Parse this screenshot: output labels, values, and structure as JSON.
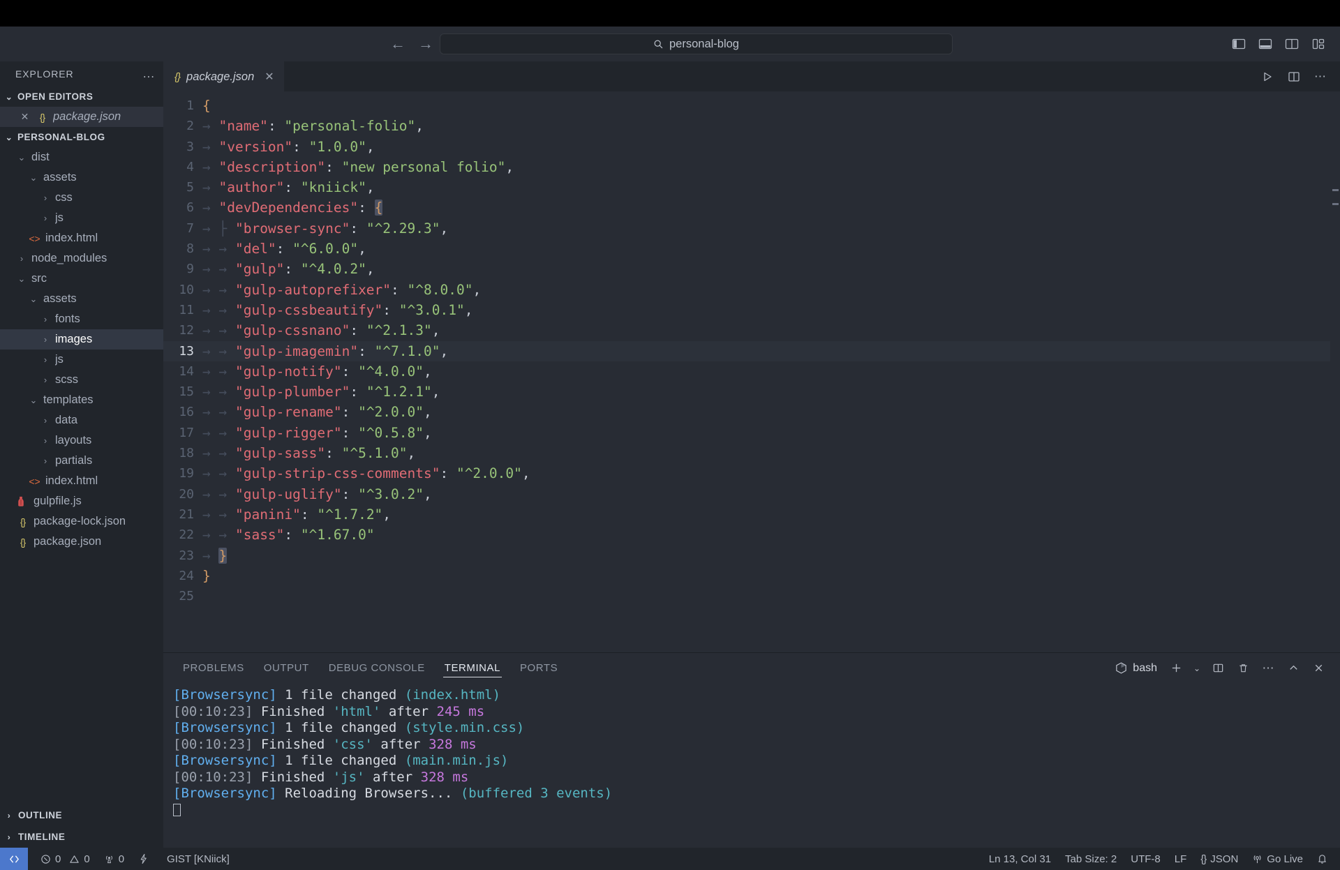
{
  "titlebar": {
    "back_icon": "arrow-left-icon",
    "forward_icon": "arrow-right-icon",
    "search_placeholder": "personal-blog",
    "search_value": "personal-blog",
    "search_icon": "search-icon",
    "layout_icons": [
      "toggle-primary-sidebar-icon",
      "toggle-panel-icon",
      "toggle-secondary-sidebar-icon",
      "customize-layout-icon"
    ]
  },
  "sidebar": {
    "header": "EXPLORER",
    "header_more": "...",
    "open_editors": {
      "label": "OPEN EDITORS",
      "items": [
        {
          "name": "package.json",
          "icon": "json-icon",
          "close_icon": "close-icon",
          "selected": true
        }
      ]
    },
    "project": {
      "label": "PERSONAL-BLOG",
      "tree": [
        {
          "name": "dist",
          "type": "folder",
          "expanded": true,
          "depth": 1
        },
        {
          "name": "assets",
          "type": "folder",
          "expanded": true,
          "depth": 2
        },
        {
          "name": "css",
          "type": "folder",
          "expanded": false,
          "depth": 3
        },
        {
          "name": "js",
          "type": "folder",
          "expanded": false,
          "depth": 3
        },
        {
          "name": "index.html",
          "type": "html",
          "depth": 2
        },
        {
          "name": "node_modules",
          "type": "folder",
          "expanded": false,
          "depth": 1
        },
        {
          "name": "src",
          "type": "folder",
          "expanded": true,
          "depth": 1
        },
        {
          "name": "assets",
          "type": "folder",
          "expanded": true,
          "depth": 2
        },
        {
          "name": "fonts",
          "type": "folder",
          "expanded": false,
          "depth": 3
        },
        {
          "name": "images",
          "type": "folder",
          "expanded": false,
          "depth": 3,
          "selected": true
        },
        {
          "name": "js",
          "type": "folder",
          "expanded": false,
          "depth": 3
        },
        {
          "name": "scss",
          "type": "folder",
          "expanded": false,
          "depth": 3
        },
        {
          "name": "templates",
          "type": "folder",
          "expanded": true,
          "depth": 2
        },
        {
          "name": "data",
          "type": "folder",
          "expanded": false,
          "depth": 3
        },
        {
          "name": "layouts",
          "type": "folder",
          "expanded": false,
          "depth": 3
        },
        {
          "name": "partials",
          "type": "folder",
          "expanded": false,
          "depth": 3
        },
        {
          "name": "index.html",
          "type": "html",
          "depth": 2
        },
        {
          "name": "gulpfile.js",
          "type": "gulp",
          "depth": 1
        },
        {
          "name": "package-lock.json",
          "type": "json",
          "depth": 1
        },
        {
          "name": "package.json",
          "type": "json",
          "depth": 1
        }
      ]
    },
    "footer": [
      {
        "label": "OUTLINE"
      },
      {
        "label": "TIMELINE"
      }
    ]
  },
  "editor": {
    "tabs": [
      {
        "label": "package.json",
        "icon": "json-icon",
        "close_icon": "close-icon",
        "active": true
      }
    ],
    "actions": [
      "run-icon",
      "split-editor-icon",
      "more-actions-icon"
    ],
    "active_line": 13,
    "lines": [
      {
        "n": 1,
        "tokens": [
          {
            "t": "{",
            "c": "b"
          }
        ]
      },
      {
        "n": 2,
        "tokens": [
          {
            "t": "→ ",
            "c": "ind"
          },
          {
            "t": "\"name\"",
            "c": "k"
          },
          {
            "t": ": ",
            "c": "p"
          },
          {
            "t": "\"personal-folio\"",
            "c": "s"
          },
          {
            "t": ",",
            "c": "p"
          }
        ]
      },
      {
        "n": 3,
        "tokens": [
          {
            "t": "→ ",
            "c": "ind"
          },
          {
            "t": "\"version\"",
            "c": "k"
          },
          {
            "t": ": ",
            "c": "p"
          },
          {
            "t": "\"1.0.0\"",
            "c": "s"
          },
          {
            "t": ",",
            "c": "p"
          }
        ]
      },
      {
        "n": 4,
        "tokens": [
          {
            "t": "→ ",
            "c": "ind"
          },
          {
            "t": "\"description\"",
            "c": "k"
          },
          {
            "t": ": ",
            "c": "p"
          },
          {
            "t": "\"new personal folio\"",
            "c": "s"
          },
          {
            "t": ",",
            "c": "p"
          }
        ]
      },
      {
        "n": 5,
        "tokens": [
          {
            "t": "→ ",
            "c": "ind"
          },
          {
            "t": "\"author\"",
            "c": "k"
          },
          {
            "t": ": ",
            "c": "p"
          },
          {
            "t": "\"kniick\"",
            "c": "s"
          },
          {
            "t": ",",
            "c": "p"
          }
        ]
      },
      {
        "n": 6,
        "tokens": [
          {
            "t": "→ ",
            "c": "ind"
          },
          {
            "t": "\"devDependencies\"",
            "c": "k"
          },
          {
            "t": ": ",
            "c": "p"
          },
          {
            "t": "{",
            "c": "b brk-hl"
          }
        ]
      },
      {
        "n": 7,
        "tokens": [
          {
            "t": "→ ├ ",
            "c": "ind"
          },
          {
            "t": "\"browser-sync\"",
            "c": "k"
          },
          {
            "t": ": ",
            "c": "p"
          },
          {
            "t": "\"^2.29.3\"",
            "c": "s"
          },
          {
            "t": ",",
            "c": "p"
          }
        ]
      },
      {
        "n": 8,
        "tokens": [
          {
            "t": "→ → ",
            "c": "ind"
          },
          {
            "t": "\"del\"",
            "c": "k"
          },
          {
            "t": ": ",
            "c": "p"
          },
          {
            "t": "\"^6.0.0\"",
            "c": "s"
          },
          {
            "t": ",",
            "c": "p"
          }
        ]
      },
      {
        "n": 9,
        "tokens": [
          {
            "t": "→ → ",
            "c": "ind"
          },
          {
            "t": "\"gulp\"",
            "c": "k"
          },
          {
            "t": ": ",
            "c": "p"
          },
          {
            "t": "\"^4.0.2\"",
            "c": "s"
          },
          {
            "t": ",",
            "c": "p"
          }
        ]
      },
      {
        "n": 10,
        "tokens": [
          {
            "t": "→ → ",
            "c": "ind"
          },
          {
            "t": "\"gulp-autoprefixer\"",
            "c": "k"
          },
          {
            "t": ": ",
            "c": "p"
          },
          {
            "t": "\"^8.0.0\"",
            "c": "s"
          },
          {
            "t": ",",
            "c": "p"
          }
        ]
      },
      {
        "n": 11,
        "tokens": [
          {
            "t": "→ → ",
            "c": "ind"
          },
          {
            "t": "\"gulp-cssbeautify\"",
            "c": "k"
          },
          {
            "t": ": ",
            "c": "p"
          },
          {
            "t": "\"^3.0.1\"",
            "c": "s"
          },
          {
            "t": ",",
            "c": "p"
          }
        ]
      },
      {
        "n": 12,
        "tokens": [
          {
            "t": "→ → ",
            "c": "ind"
          },
          {
            "t": "\"gulp-cssnano\"",
            "c": "k"
          },
          {
            "t": ": ",
            "c": "p"
          },
          {
            "t": "\"^2.1.3\"",
            "c": "s"
          },
          {
            "t": ",",
            "c": "p"
          }
        ]
      },
      {
        "n": 13,
        "tokens": [
          {
            "t": "→ → ",
            "c": "ind"
          },
          {
            "t": "\"gulp-imagemin\"",
            "c": "k"
          },
          {
            "t": ": ",
            "c": "p"
          },
          {
            "t": "\"^7.1.0\"",
            "c": "s"
          },
          {
            "t": ",",
            "c": "p"
          }
        ]
      },
      {
        "n": 14,
        "tokens": [
          {
            "t": "→ → ",
            "c": "ind"
          },
          {
            "t": "\"gulp-notify\"",
            "c": "k"
          },
          {
            "t": ": ",
            "c": "p"
          },
          {
            "t": "\"^4.0.0\"",
            "c": "s"
          },
          {
            "t": ",",
            "c": "p"
          }
        ]
      },
      {
        "n": 15,
        "tokens": [
          {
            "t": "→ → ",
            "c": "ind"
          },
          {
            "t": "\"gulp-plumber\"",
            "c": "k"
          },
          {
            "t": ": ",
            "c": "p"
          },
          {
            "t": "\"^1.2.1\"",
            "c": "s"
          },
          {
            "t": ",",
            "c": "p"
          }
        ]
      },
      {
        "n": 16,
        "tokens": [
          {
            "t": "→ → ",
            "c": "ind"
          },
          {
            "t": "\"gulp-rename\"",
            "c": "k"
          },
          {
            "t": ": ",
            "c": "p"
          },
          {
            "t": "\"^2.0.0\"",
            "c": "s"
          },
          {
            "t": ",",
            "c": "p"
          }
        ]
      },
      {
        "n": 17,
        "tokens": [
          {
            "t": "→ → ",
            "c": "ind"
          },
          {
            "t": "\"gulp-rigger\"",
            "c": "k"
          },
          {
            "t": ": ",
            "c": "p"
          },
          {
            "t": "\"^0.5.8\"",
            "c": "s"
          },
          {
            "t": ",",
            "c": "p"
          }
        ]
      },
      {
        "n": 18,
        "tokens": [
          {
            "t": "→ → ",
            "c": "ind"
          },
          {
            "t": "\"gulp-sass\"",
            "c": "k"
          },
          {
            "t": ": ",
            "c": "p"
          },
          {
            "t": "\"^5.1.0\"",
            "c": "s"
          },
          {
            "t": ",",
            "c": "p"
          }
        ]
      },
      {
        "n": 19,
        "tokens": [
          {
            "t": "→ → ",
            "c": "ind"
          },
          {
            "t": "\"gulp-strip-css-comments\"",
            "c": "k"
          },
          {
            "t": ": ",
            "c": "p"
          },
          {
            "t": "\"^2.0.0\"",
            "c": "s"
          },
          {
            "t": ",",
            "c": "p"
          }
        ]
      },
      {
        "n": 20,
        "tokens": [
          {
            "t": "→ → ",
            "c": "ind"
          },
          {
            "t": "\"gulp-uglify\"",
            "c": "k"
          },
          {
            "t": ": ",
            "c": "p"
          },
          {
            "t": "\"^3.0.2\"",
            "c": "s"
          },
          {
            "t": ",",
            "c": "p"
          }
        ]
      },
      {
        "n": 21,
        "tokens": [
          {
            "t": "→ → ",
            "c": "ind"
          },
          {
            "t": "\"panini\"",
            "c": "k"
          },
          {
            "t": ": ",
            "c": "p"
          },
          {
            "t": "\"^1.7.2\"",
            "c": "s"
          },
          {
            "t": ",",
            "c": "p"
          }
        ]
      },
      {
        "n": 22,
        "tokens": [
          {
            "t": "→ → ",
            "c": "ind"
          },
          {
            "t": "\"sass\"",
            "c": "k"
          },
          {
            "t": ": ",
            "c": "p"
          },
          {
            "t": "\"^1.67.0\"",
            "c": "s"
          }
        ]
      },
      {
        "n": 23,
        "tokens": [
          {
            "t": "→ ",
            "c": "ind"
          },
          {
            "t": "}",
            "c": "b brk-hl"
          }
        ]
      },
      {
        "n": 24,
        "tokens": [
          {
            "t": "}",
            "c": "b"
          }
        ]
      },
      {
        "n": 25,
        "tokens": []
      }
    ]
  },
  "panel": {
    "tabs": [
      {
        "label": "PROBLEMS",
        "active": false
      },
      {
        "label": "OUTPUT",
        "active": false
      },
      {
        "label": "DEBUG CONSOLE",
        "active": false
      },
      {
        "label": "TERMINAL",
        "active": true
      },
      {
        "label": "PORTS",
        "active": false
      }
    ],
    "shell_label": "bash",
    "shell_icon": "terminal-bash-icon",
    "actions": [
      "new-terminal-icon",
      "terminal-dropdown-icon",
      "split-terminal-icon",
      "kill-terminal-icon",
      "more-actions-icon",
      "maximize-panel-icon",
      "close-panel-icon"
    ],
    "terminal_lines": [
      [
        {
          "t": "[Browsersync]",
          "c": "t-blue"
        },
        {
          "t": " 1 file changed ",
          "c": "t-white"
        },
        {
          "t": "(index.html)",
          "c": "t-cyan"
        }
      ],
      [
        {
          "t": "[00:10:23]",
          "c": "t-gray"
        },
        {
          "t": " Finished ",
          "c": "t-white"
        },
        {
          "t": "'html'",
          "c": "t-cyan"
        },
        {
          "t": " after ",
          "c": "t-white"
        },
        {
          "t": "245 ms",
          "c": "t-magenta"
        }
      ],
      [
        {
          "t": "[Browsersync]",
          "c": "t-blue"
        },
        {
          "t": " 1 file changed ",
          "c": "t-white"
        },
        {
          "t": "(style.min.css)",
          "c": "t-cyan"
        }
      ],
      [
        {
          "t": "[00:10:23]",
          "c": "t-gray"
        },
        {
          "t": " Finished ",
          "c": "t-white"
        },
        {
          "t": "'css'",
          "c": "t-cyan"
        },
        {
          "t": " after ",
          "c": "t-white"
        },
        {
          "t": "328 ms",
          "c": "t-magenta"
        }
      ],
      [
        {
          "t": "[Browsersync]",
          "c": "t-blue"
        },
        {
          "t": " 1 file changed ",
          "c": "t-white"
        },
        {
          "t": "(main.min.js)",
          "c": "t-cyan"
        }
      ],
      [
        {
          "t": "[00:10:23]",
          "c": "t-gray"
        },
        {
          "t": " Finished ",
          "c": "t-white"
        },
        {
          "t": "'js'",
          "c": "t-cyan"
        },
        {
          "t": " after ",
          "c": "t-white"
        },
        {
          "t": "328 ms",
          "c": "t-magenta"
        }
      ],
      [
        {
          "t": "[Browsersync]",
          "c": "t-blue"
        },
        {
          "t": " Reloading Browsers... ",
          "c": "t-white"
        },
        {
          "t": "(buffered 3 events)",
          "c": "t-cyan"
        }
      ]
    ]
  },
  "statusbar": {
    "remote_icon": "remote-window-icon",
    "errors": "0",
    "warnings": "0",
    "ports": "0",
    "radio_tower_icon": "radio-tower-icon",
    "error_icon": "error-circle-icon",
    "warning_icon": "warning-triangle-icon",
    "lightning_icon": "lightning-icon",
    "gist_label": "GIST [KNiick]",
    "cursor_position": "Ln 13, Col 31",
    "tab_size": "Tab Size: 2",
    "encoding": "UTF-8",
    "eol": "LF",
    "language": "JSON",
    "language_icon": "json-icon",
    "go_live": "Go Live",
    "go_live_icon": "broadcast-icon",
    "bell_icon": "bell-icon"
  },
  "colors": {
    "bg_editor": "#282c34",
    "bg_sidebar": "#21252b",
    "accent_blue": "#4c78cc",
    "key": "#e06c75",
    "string": "#98c379",
    "bracket": "#d19a66"
  }
}
